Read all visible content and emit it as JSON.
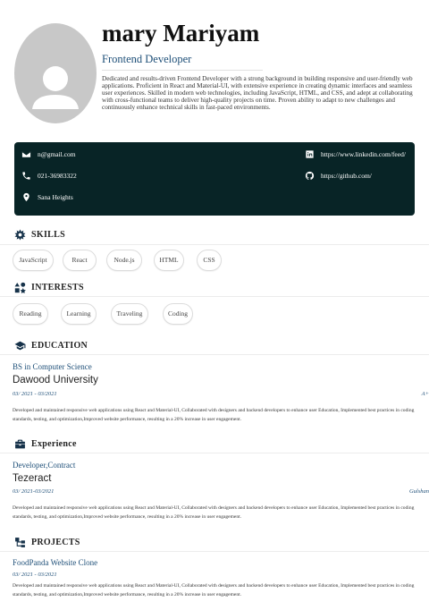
{
  "header": {
    "name": "mary Mariyam",
    "role": "Frontend Developer",
    "summary": "Dedicated and results-driven Frontend Developer with a strong background in building responsive and user-friendly web applications. Proficient in React and Material-UI, with extensive experience in creating dynamic interfaces and seamless user experiences. Skilled in modern web technologies, including JavaScript, HTML, and CSS, and adept at collaborating with cross-functional teams to deliver high-quality projects on time. Proven ability to adapt to new challenges and continuously enhance technical skills in fast-paced environments."
  },
  "contact": {
    "email": "n@gmail.com",
    "phone": "021-36983322",
    "location": "Sana Heights",
    "linkedin": "https://www.linkedin.com/feed/",
    "github": "https://github.com/"
  },
  "skills": {
    "title": "SKILLS",
    "items": [
      "JavaScript",
      "React",
      "Node.js",
      "HTML",
      "CSS"
    ]
  },
  "interests": {
    "title": "INTERESTS",
    "items": [
      "Reading",
      "Learning",
      "Traveling",
      "Coding"
    ]
  },
  "education": {
    "title": "EDUCATION",
    "degree": "BS in Computer Science",
    "school": "Dawood University",
    "dates": "03/ 2021 - 03/2021",
    "grade": "A+",
    "description": "Developed and maintained responsive web applications using React and Material-UI, Collaborated with designers and backend developers to enhance user Education, Implemented best practices in coding standards, testing, and optimization,Improved website performance, resulting in a 20% increase in user engagement."
  },
  "experience": {
    "title": "Experience",
    "position": "Developer,Contract",
    "company": "Tezeract",
    "dates": "03/ 2021-03/2021",
    "location": "Gulshan",
    "description": "Developed and maintained responsive web applications using React and Material-UI, Collaborated with designers and backend developers to enhance user Education, Implemented best practices in coding standards, testing, and optimization,Improved website performance, resulting in a 20% increase in user engagement."
  },
  "projects": {
    "title": "PROJECTS",
    "name": "FoodPanda Website Clone",
    "dates": "03/ 2021 - 03/2021",
    "description": "Developed and maintained responsive web applications using React and Material-UI, Collaborated with designers and backend developers to enhance user Education, Implemented best practices in coding standards, testing, and optimization,Improved website performance, resulting in a 20% increase in user engagement."
  },
  "colors": {
    "contact_bg": "#082426",
    "accent": "#1e4f78",
    "avatar_bg": "#c8c8c8"
  },
  "icons": [
    "avatar-person-icon",
    "email-icon",
    "phone-icon",
    "location-pin-icon",
    "linkedin-icon",
    "github-icon",
    "skills-icon",
    "interests-icon",
    "education-cap-icon",
    "briefcase-icon",
    "projects-icon"
  ]
}
